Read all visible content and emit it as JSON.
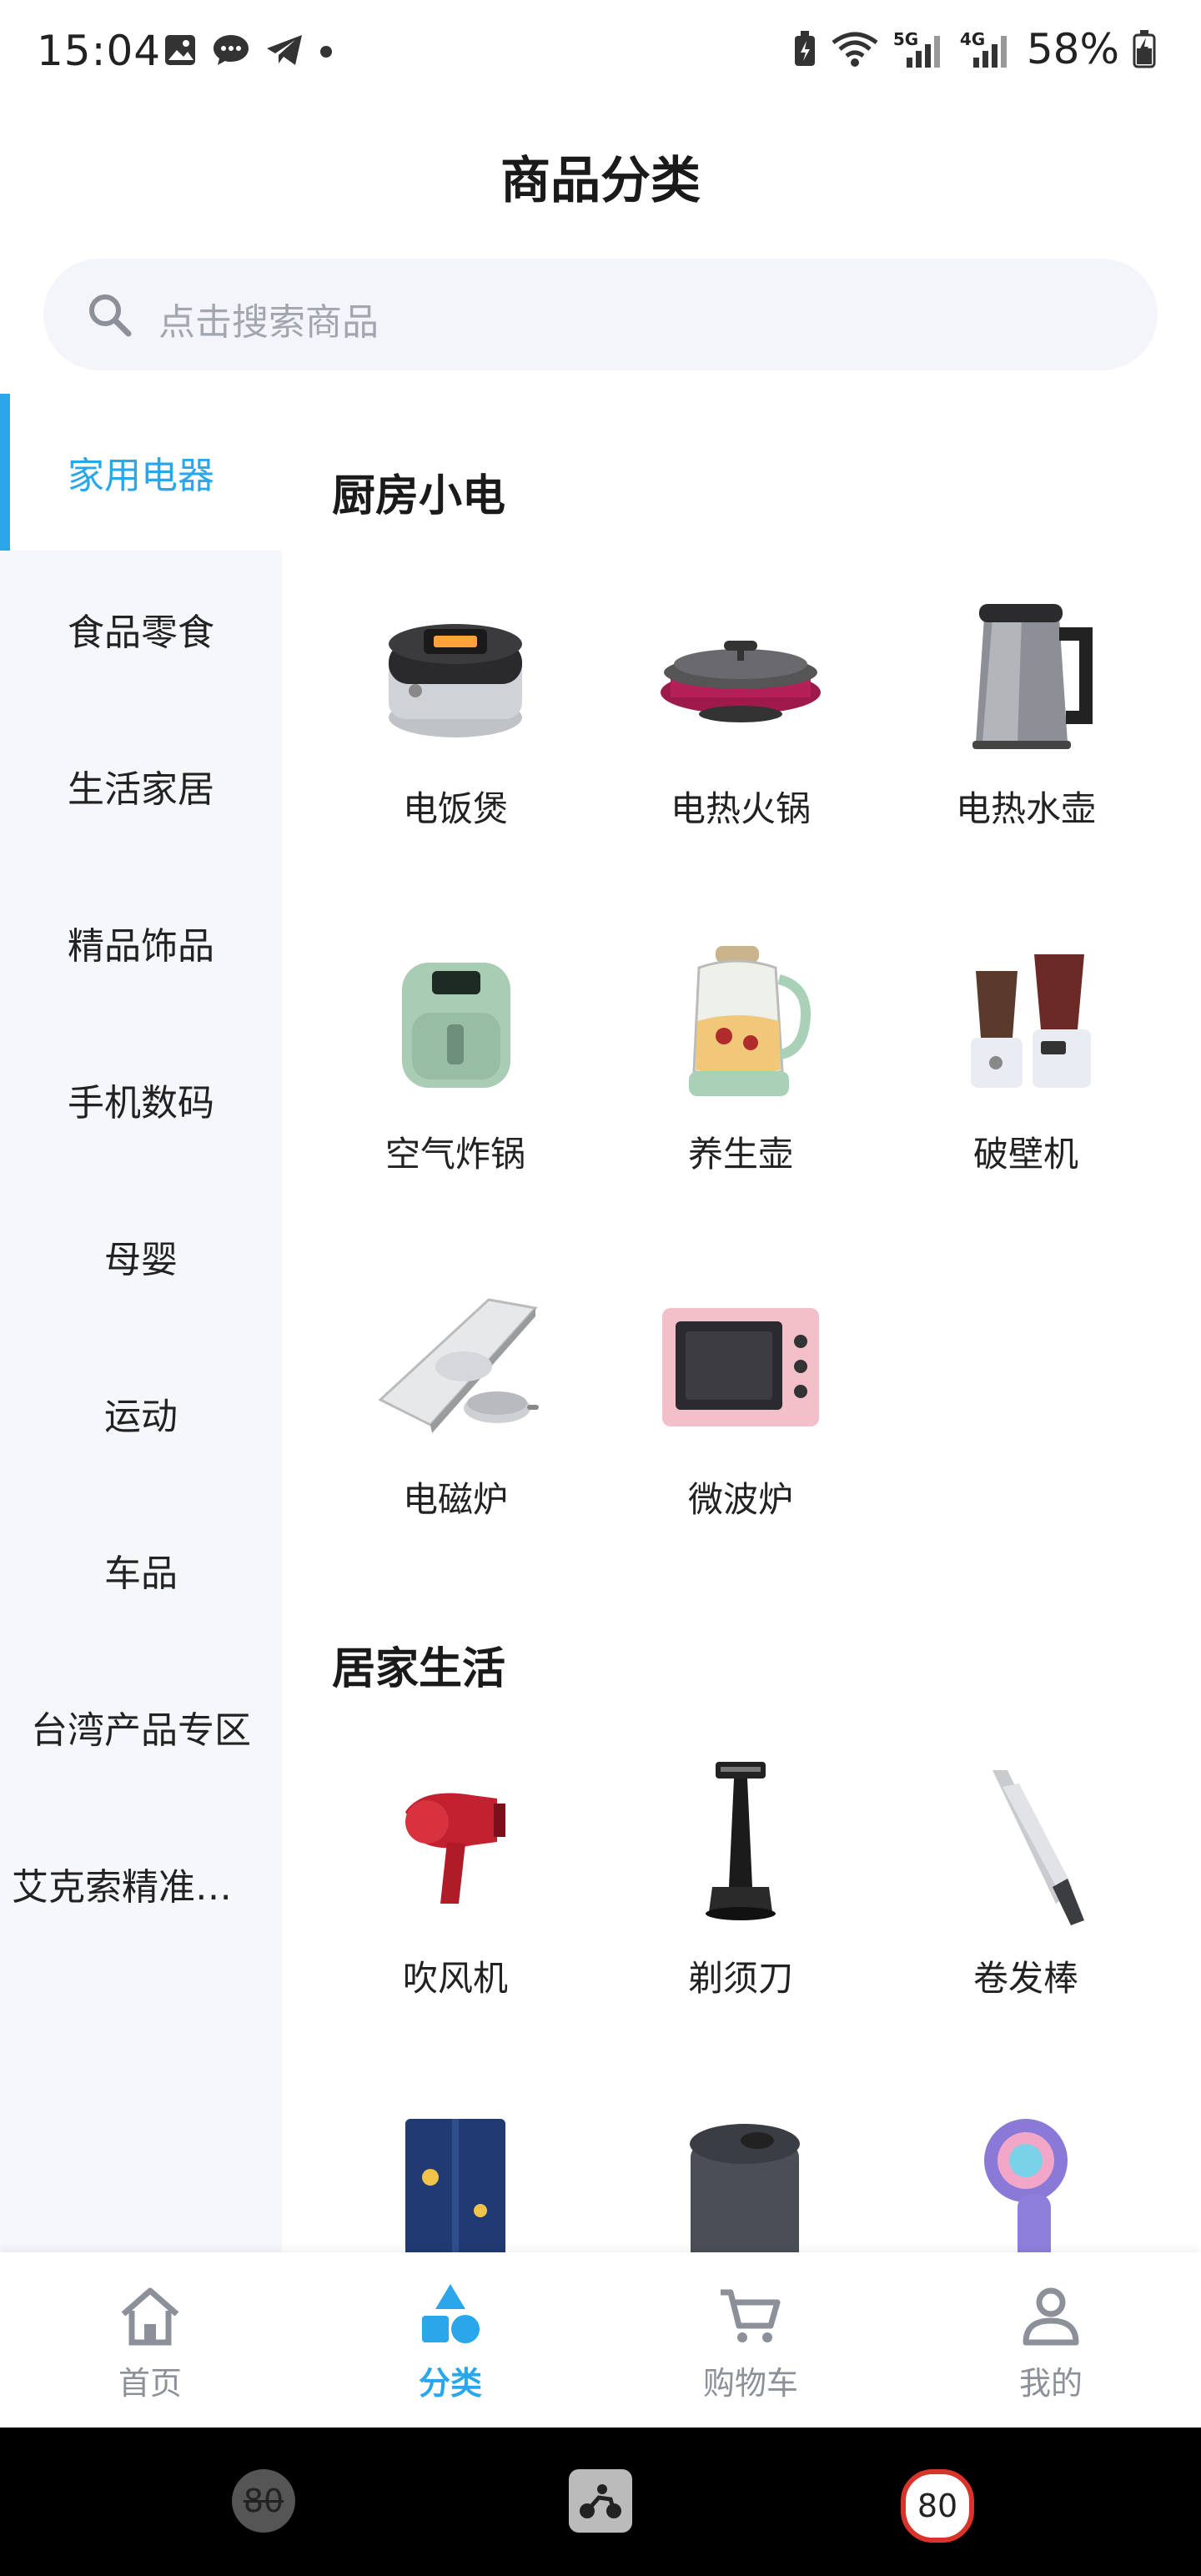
{
  "status_bar": {
    "time": "15:04",
    "battery_text": "58%",
    "network_labels": [
      "5G",
      "4G"
    ]
  },
  "page": {
    "title": "商品分类"
  },
  "search": {
    "placeholder": "点击搜索商品"
  },
  "sidebar": {
    "items": [
      {
        "label": "家用电器",
        "active": true
      },
      {
        "label": "食品零食"
      },
      {
        "label": "生活家居"
      },
      {
        "label": "精品饰品"
      },
      {
        "label": "手机数码"
      },
      {
        "label": "母婴"
      },
      {
        "label": "运动"
      },
      {
        "label": "车品"
      },
      {
        "label": "台湾产品专区"
      },
      {
        "label": "艾克索精准…"
      }
    ]
  },
  "sections": [
    {
      "title": "厨房小电",
      "items": [
        {
          "label": "电饭煲",
          "icon": "rice-cooker-icon"
        },
        {
          "label": "电热火锅",
          "icon": "electric-hotpot-icon"
        },
        {
          "label": "电热水壶",
          "icon": "electric-kettle-icon"
        },
        {
          "label": "空气炸锅",
          "icon": "air-fryer-icon"
        },
        {
          "label": "养生壶",
          "icon": "health-pot-icon"
        },
        {
          "label": "破壁机",
          "icon": "blender-icon"
        },
        {
          "label": "电磁炉",
          "icon": "induction-cooker-icon"
        },
        {
          "label": "微波炉",
          "icon": "microwave-icon"
        }
      ]
    },
    {
      "title": "居家生活",
      "items": [
        {
          "label": "吹风机",
          "icon": "hair-dryer-icon"
        },
        {
          "label": "剃须刀",
          "icon": "razor-icon"
        },
        {
          "label": "卷发棒",
          "icon": "curling-iron-icon"
        },
        {
          "label": "",
          "icon": "clothes-dryer-icon"
        },
        {
          "label": "",
          "icon": "trash-bin-icon"
        },
        {
          "label": "",
          "icon": "lint-remover-icon"
        }
      ]
    }
  ],
  "tabbar": {
    "items": [
      {
        "label": "首页",
        "icon": "home-icon"
      },
      {
        "label": "分类",
        "icon": "category-icon",
        "active": true
      },
      {
        "label": "购物车",
        "icon": "cart-icon"
      },
      {
        "label": "我的",
        "icon": "profile-icon"
      }
    ]
  },
  "system_nav": {
    "left_text": "80",
    "right_text": "80"
  },
  "colors": {
    "accent": "#2aa6ea",
    "sidebar_bg": "#f5f7fb",
    "search_bg": "#f3f5fa"
  }
}
